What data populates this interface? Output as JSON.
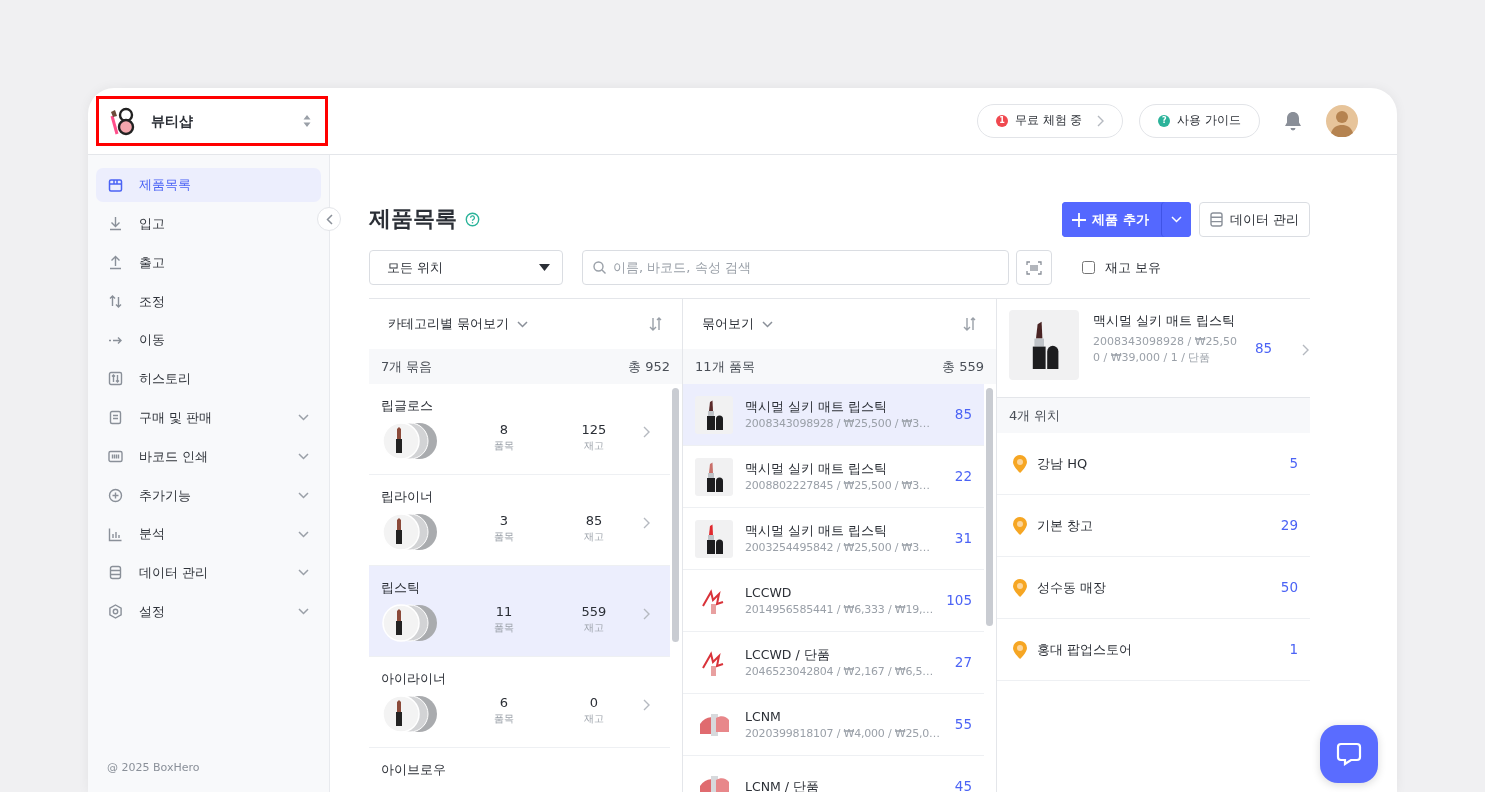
{
  "shop_selector": {
    "name": "뷰티샵",
    "highlighted": true
  },
  "header": {
    "trial_button": {
      "badge": "1",
      "label": "무료 체험 중"
    },
    "guide_button": {
      "badge": "?",
      "label": "사용 가이드"
    }
  },
  "sidebar": {
    "items": [
      {
        "label": "제품목록",
        "selected": true,
        "expandable": false
      },
      {
        "label": "입고",
        "selected": false,
        "expandable": false
      },
      {
        "label": "출고",
        "selected": false,
        "expandable": false
      },
      {
        "label": "조정",
        "selected": false,
        "expandable": false
      },
      {
        "label": "이동",
        "selected": false,
        "expandable": false
      },
      {
        "label": "히스토리",
        "selected": false,
        "expandable": false
      },
      {
        "label": "구매 및 판매",
        "selected": false,
        "expandable": true
      },
      {
        "label": "바코드 인쇄",
        "selected": false,
        "expandable": true
      },
      {
        "label": "추가기능",
        "selected": false,
        "expandable": true
      },
      {
        "label": "분석",
        "selected": false,
        "expandable": true
      },
      {
        "label": "데이터 관리",
        "selected": false,
        "expandable": true
      },
      {
        "label": "설정",
        "selected": false,
        "expandable": true
      }
    ],
    "footer": "@ 2025 BoxHero"
  },
  "page": {
    "title": "제품목록",
    "add_button": "제품 추가",
    "data_button": "데이터 관리",
    "location_select": "모든 위치",
    "search": {
      "placeholder": "이름, 바코드, 속성 검색"
    },
    "in_stock_filter": {
      "label": "재고 보유",
      "checked": false
    }
  },
  "category_panel": {
    "group_by": "카테고리별 묶어보기",
    "count": "7개 묶음",
    "total": "총 952",
    "rows": [
      {
        "name": "립글로스",
        "items": "8",
        "items_label": "품목",
        "stock": "125",
        "stock_label": "재고",
        "selected": false
      },
      {
        "name": "립라이너",
        "items": "3",
        "items_label": "품목",
        "stock": "85",
        "stock_label": "재고",
        "selected": false
      },
      {
        "name": "립스틱",
        "items": "11",
        "items_label": "품목",
        "stock": "559",
        "stock_label": "재고",
        "selected": true
      },
      {
        "name": "아이라이너",
        "items": "6",
        "items_label": "품목",
        "stock": "0",
        "stock_label": "재고",
        "selected": false
      },
      {
        "name": "아이브로우",
        "selected": false
      }
    ]
  },
  "product_panel": {
    "group_by": "묶어보기",
    "count": "11개 품목",
    "total": "총 559",
    "rows": [
      {
        "kind": "photo",
        "color": "#5a2a2a",
        "name": "맥시멀 실키 매트 립스틱",
        "detail": "2008343098928 / ₩25,500 / ₩3…",
        "qty": "85",
        "selected": true
      },
      {
        "kind": "photo",
        "color": "#c9706a",
        "name": "맥시멀 실키 매트 립스틱",
        "detail": "2008802227845 / ₩25,500 / ₩3…",
        "qty": "22",
        "selected": false
      },
      {
        "kind": "photo",
        "color": "#e0282e",
        "name": "맥시멀 실키 매트 립스틱",
        "detail": "2003254495842 / ₩25,500 / ₩3…",
        "qty": "31",
        "selected": false
      },
      {
        "kind": "scribble",
        "name": "LCCWD",
        "detail": "2014956585441 / ₩6,333 / ₩19,…",
        "qty": "105",
        "selected": false
      },
      {
        "kind": "scribble",
        "name": "LCCWD / 단품",
        "detail": "2046523042804 / ₩2,167 / ₩6,5…",
        "qty": "27",
        "selected": false
      },
      {
        "kind": "bullets",
        "name": "LCNM",
        "detail": "2020399818107 / ₩4,000 / ₩25,0…",
        "qty": "55",
        "selected": false
      },
      {
        "kind": "bullets",
        "name": "LCNM / 단품",
        "qty": "45",
        "selected": false
      }
    ]
  },
  "detail_panel": {
    "product": {
      "color": "#4a2424",
      "name": "맥시멀 실키 매트 립스틱",
      "detail": "2008343098928 / ₩25,500 / ₩39,000 / 1 / 단품",
      "qty": "85"
    },
    "locations_count": "4개 위치",
    "locations": [
      {
        "name": "강남 HQ",
        "qty": "5"
      },
      {
        "name": "기본 창고",
        "qty": "29"
      },
      {
        "name": "성수동 매장",
        "qty": "50"
      },
      {
        "name": "홍대 팝업스토어",
        "qty": "1"
      }
    ]
  }
}
